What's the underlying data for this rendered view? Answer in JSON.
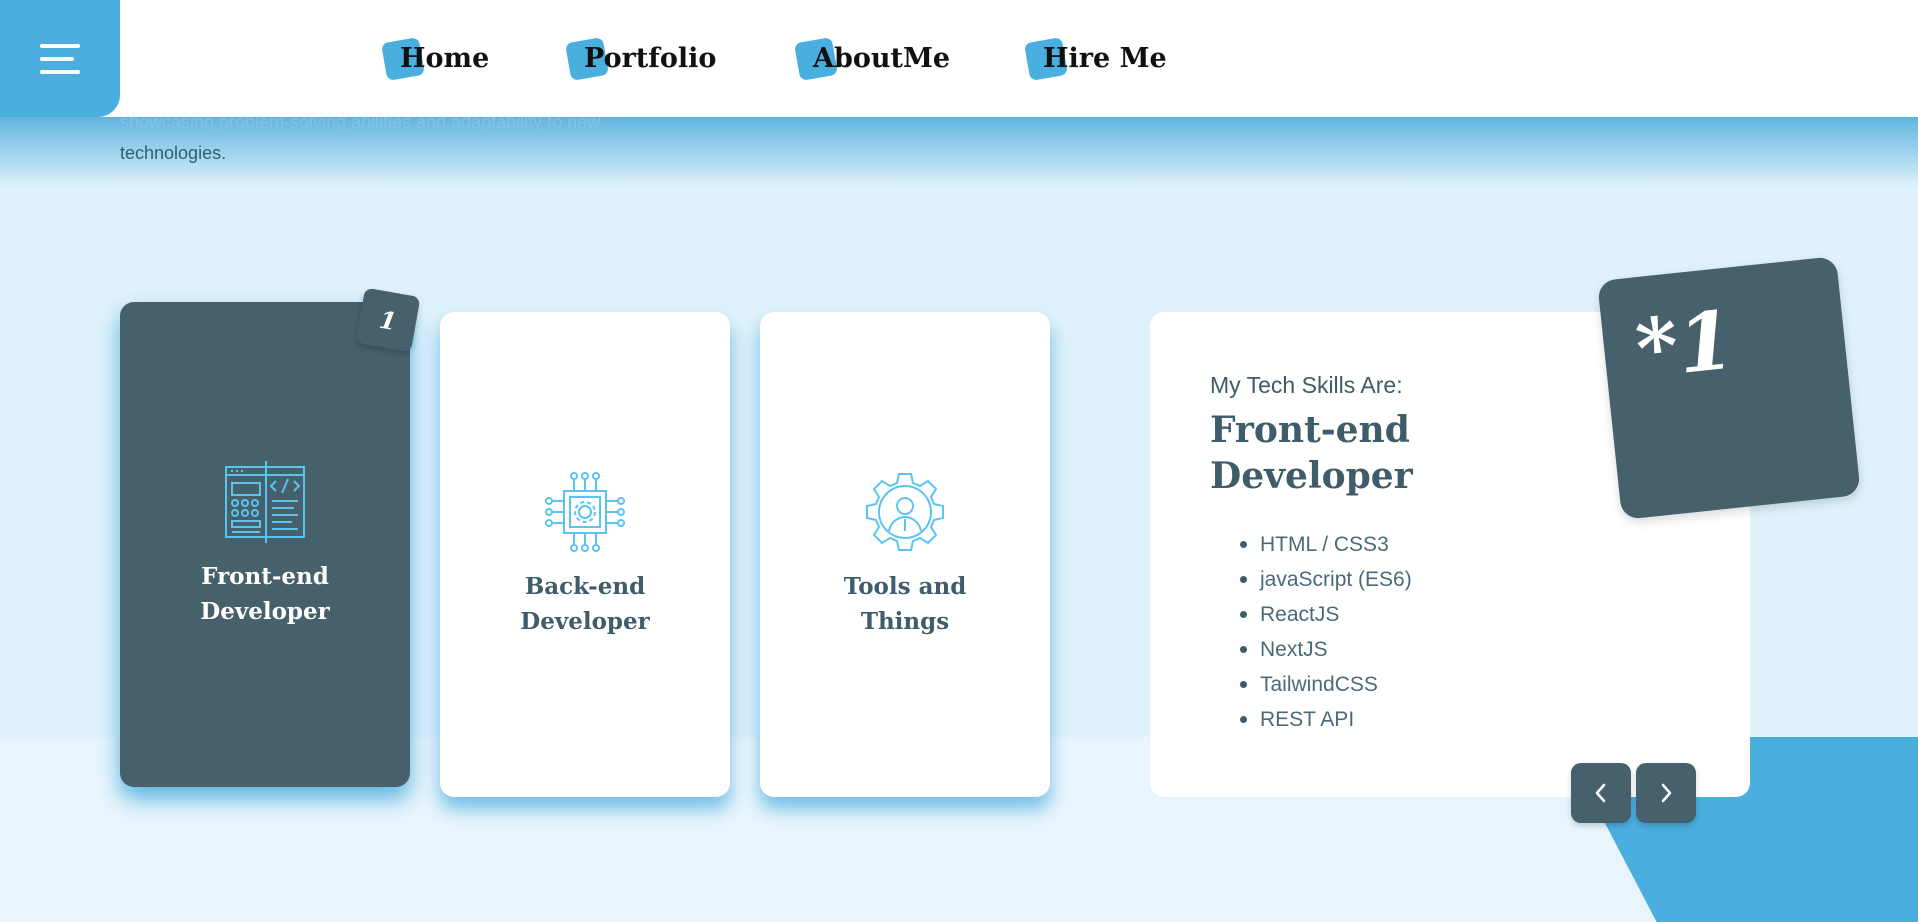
{
  "colors": {
    "accent": "#4aaede",
    "dark": "#46606c",
    "background": "#e9f5fc",
    "band": "#dff1fb",
    "card": "#ffffff"
  },
  "nav": {
    "menu_icon": "hamburger-menu-icon",
    "links": [
      {
        "label": "Home"
      },
      {
        "label": "Portfolio"
      },
      {
        "label": "AboutMe"
      },
      {
        "label": "Hire Me"
      }
    ]
  },
  "intro": {
    "line1": "showcasing problem-solving abilities and adaptability to new",
    "line2": "technologies."
  },
  "cards": [
    {
      "title": "Front-end\nDeveloper",
      "icon": "code-window-icon",
      "active": true,
      "badge": "1"
    },
    {
      "title": "Back-end\nDeveloper",
      "icon": "circuit-chip-gear-icon",
      "active": false
    },
    {
      "title": "Tools and\nThings",
      "icon": "gear-person-icon",
      "active": false
    }
  ],
  "detail": {
    "subtitle": "My Tech Skills Are:",
    "heading": "Front-end Developer",
    "badge": "*1",
    "skills": [
      "HTML / CSS3",
      "javaScript (ES6)",
      "ReactJS",
      "NextJS",
      "TailwindCSS",
      "REST API"
    ]
  },
  "pager": {
    "prev_icon": "chevron-left-icon",
    "next_icon": "chevron-right-icon"
  }
}
